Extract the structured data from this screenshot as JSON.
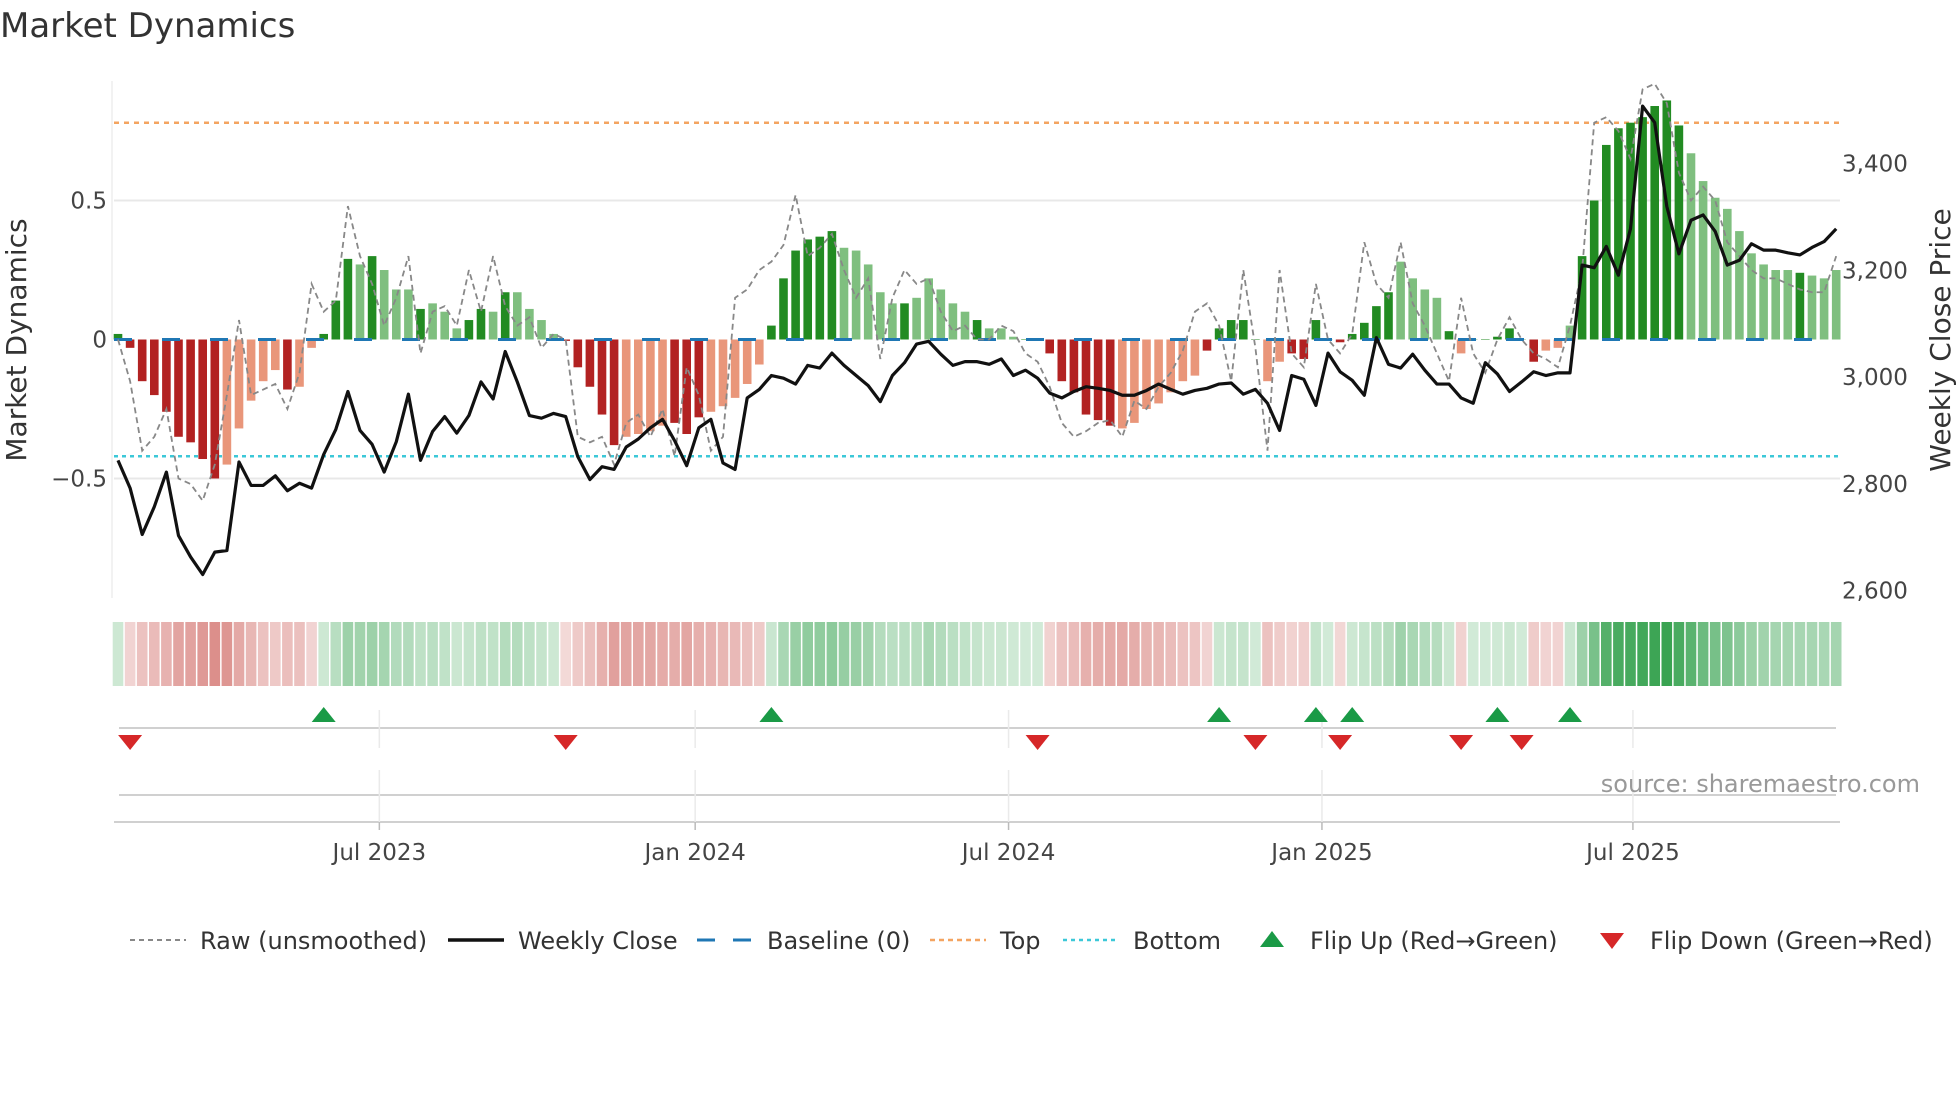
{
  "title": "Market Dynamics",
  "source": "source: sharemaestro.com",
  "colors": {
    "bar_up_strong": "#228b22",
    "bar_up_weak": "#7fbf7f",
    "bar_down_strong": "#b22222",
    "bar_down_weak": "#e9967a",
    "close": "#111111",
    "raw": "#888888",
    "baseline": "#1f77b4",
    "top": "#f4a460",
    "bottom": "#3cc8d8",
    "strip_up": "#2e9e48",
    "strip_down": "#c8504a",
    "flip_up": "#1a9a46",
    "flip_down": "#d62728"
  },
  "chart_data": {
    "type": "bar+line",
    "title": "Market Dynamics",
    "ylabel": "Market Dynamics",
    "y2label": "Weekly Close Price",
    "ylim": [
      -0.93,
      0.93
    ],
    "y2lim": [
      2586,
      3555
    ],
    "yticks": [
      {
        "v": 0.5,
        "label": "0.5"
      },
      {
        "v": 0,
        "label": "0"
      },
      {
        "v": -0.5,
        "label": "−0.5"
      }
    ],
    "y2ticks": [
      {
        "v": 3400,
        "label": "3,400"
      },
      {
        "v": 3200,
        "label": "3,200"
      },
      {
        "v": 3000,
        "label": "3,000"
      },
      {
        "v": 2800,
        "label": "2,800"
      },
      {
        "v": 2600,
        "label": "2,600"
      }
    ],
    "xticks": [
      {
        "week": 21.6,
        "label": "Jul 2023"
      },
      {
        "week": 47.7,
        "label": "Jan 2024"
      },
      {
        "week": 73.6,
        "label": "Jul 2024"
      },
      {
        "week": 99.5,
        "label": "Jan 2025"
      },
      {
        "week": 125.2,
        "label": "Jul 2025"
      }
    ],
    "thresholds": {
      "top": 0.78,
      "bottom": -0.42,
      "baseline": 0
    },
    "dynamics": [
      0.02,
      -0.03,
      -0.15,
      -0.2,
      -0.26,
      -0.35,
      -0.37,
      -0.43,
      -0.5,
      -0.45,
      -0.32,
      -0.22,
      -0.15,
      -0.11,
      -0.18,
      -0.17,
      -0.03,
      0.02,
      0.14,
      0.29,
      0.27,
      0.3,
      0.25,
      0.18,
      0.18,
      0.11,
      0.13,
      0.1,
      0.04,
      0.07,
      0.11,
      0.1,
      0.17,
      0.17,
      0.11,
      0.07,
      0.02,
      -0.005,
      -0.1,
      -0.17,
      -0.27,
      -0.38,
      -0.35,
      -0.34,
      -0.33,
      -0.31,
      -0.3,
      -0.34,
      -0.28,
      -0.26,
      -0.24,
      -0.21,
      -0.16,
      -0.09,
      0.05,
      0.22,
      0.32,
      0.36,
      0.37,
      0.39,
      0.33,
      0.32,
      0.27,
      0.17,
      0.13,
      0.13,
      0.15,
      0.22,
      0.18,
      0.13,
      0.1,
      0.07,
      0.04,
      0.04,
      0.01,
      0.0,
      0.0,
      -0.05,
      -0.15,
      -0.19,
      -0.27,
      -0.29,
      -0.31,
      -0.32,
      -0.3,
      -0.25,
      -0.23,
      -0.19,
      -0.15,
      -0.13,
      -0.04,
      0.04,
      0.07,
      0.07,
      0.0,
      -0.15,
      -0.08,
      -0.05,
      -0.07,
      0.07,
      0.0,
      -0.01,
      0.02,
      0.06,
      0.12,
      0.17,
      0.28,
      0.22,
      0.18,
      0.15,
      0.03,
      -0.05,
      0.0,
      0.0,
      0.01,
      0.04,
      0.0,
      -0.08,
      -0.04,
      -0.03,
      0.05,
      0.3,
      0.5,
      0.7,
      0.76,
      0.78,
      0.8,
      0.84,
      0.86,
      0.77,
      0.67,
      0.57,
      0.51,
      0.47,
      0.39,
      0.31,
      0.27,
      0.25,
      0.25,
      0.24,
      0.23,
      0.22,
      0.25
    ],
    "strength": "dddddddddllllldlldddldllldlllddldlllldddddlllldddlllllddddddllllldllllldlllddddddddllllllldddddlldddddddddlllldlldddldllldddddddddllllllllldllld",
    "raw": [
      0.0,
      -0.15,
      -0.4,
      -0.35,
      -0.25,
      -0.5,
      -0.52,
      -0.58,
      -0.45,
      -0.2,
      0.07,
      -0.2,
      -0.18,
      -0.16,
      -0.25,
      -0.12,
      0.2,
      0.1,
      0.14,
      0.48,
      0.3,
      0.2,
      0.05,
      0.15,
      0.3,
      -0.05,
      0.1,
      0.12,
      0.05,
      0.25,
      0.1,
      0.3,
      0.12,
      0.05,
      0.08,
      -0.03,
      0.02,
      0.0,
      -0.35,
      -0.37,
      -0.35,
      -0.45,
      -0.3,
      -0.27,
      -0.35,
      -0.25,
      -0.42,
      -0.1,
      -0.2,
      -0.4,
      -0.35,
      0.15,
      0.18,
      0.25,
      0.28,
      0.34,
      0.52,
      0.3,
      0.33,
      0.38,
      0.25,
      0.15,
      0.22,
      -0.07,
      0.15,
      0.25,
      0.2,
      0.22,
      0.1,
      0.03,
      0.05,
      0.0,
      0.0,
      0.05,
      0.03,
      -0.05,
      -0.08,
      -0.17,
      -0.3,
      -0.35,
      -0.33,
      -0.3,
      -0.29,
      -0.35,
      -0.22,
      -0.25,
      -0.17,
      -0.12,
      -0.04,
      0.1,
      0.13,
      0.05,
      -0.15,
      0.25,
      -0.03,
      -0.4,
      0.25,
      -0.05,
      -0.1,
      0.2,
      0.0,
      -0.05,
      0.02,
      0.35,
      0.2,
      0.15,
      0.35,
      0.13,
      0.05,
      -0.05,
      -0.15,
      0.15,
      -0.05,
      -0.12,
      0.0,
      0.08,
      0.0,
      -0.05,
      -0.07,
      -0.1,
      0.05,
      0.25,
      0.78,
      0.8,
      0.75,
      0.65,
      0.9,
      0.92,
      0.85,
      0.6,
      0.5,
      0.55,
      0.5,
      0.35,
      0.3,
      0.25,
      0.22,
      0.22,
      0.2,
      0.18,
      0.17,
      0.17,
      0.3
    ],
    "close": [
      2844,
      2792,
      2705,
      2757,
      2822,
      2703,
      2663,
      2630,
      2672,
      2675,
      2841,
      2797,
      2797,
      2815,
      2787,
      2801,
      2792,
      2855,
      2902,
      2973,
      2900,
      2874,
      2822,
      2879,
      2968,
      2844,
      2898,
      2926,
      2895,
      2928,
      2991,
      2959,
      3048,
      2991,
      2928,
      2923,
      2932,
      2926,
      2851,
      2808,
      2832,
      2827,
      2869,
      2884,
      2905,
      2921,
      2881,
      2834,
      2905,
      2921,
      2839,
      2827,
      2961,
      2977,
      3003,
      2998,
      2987,
      3022,
      3017,
      3045,
      3022,
      3003,
      2984,
      2954,
      3003,
      3027,
      3062,
      3067,
      3043,
      3022,
      3029,
      3029,
      3024,
      3034,
      3003,
      3013,
      2998,
      2970,
      2961,
      2973,
      2982,
      2979,
      2975,
      2966,
      2966,
      2975,
      2987,
      2977,
      2968,
      2975,
      2979,
      2987,
      2989,
      2968,
      2977,
      2951,
      2900,
      3003,
      2996,
      2947,
      3045,
      3010,
      2994,
      2966,
      3074,
      3024,
      3017,
      3043,
      3013,
      2987,
      2987,
      2961,
      2951,
      3027,
      3006,
      2973,
      2991,
      3010,
      3003,
      3008,
      3008,
      3210,
      3205,
      3245,
      3191,
      3278,
      3508,
      3477,
      3320,
      3231,
      3294,
      3304,
      3273,
      3210,
      3219,
      3250,
      3238,
      3238,
      3233,
      3229,
      3243,
      3254,
      3278
    ],
    "flip_up_weeks": [
      17,
      54,
      91,
      99,
      102,
      114,
      120
    ],
    "flip_down_weeks": [
      1,
      37,
      76,
      94,
      101,
      111,
      116
    ],
    "legend": {
      "position": "bottom",
      "items": [
        "Raw (unsmoothed)",
        "Weekly Close",
        "Baseline (0)",
        "Top",
        "Bottom",
        "Flip Up (Red→Green)",
        "Flip Down (Green→Red)"
      ]
    }
  }
}
